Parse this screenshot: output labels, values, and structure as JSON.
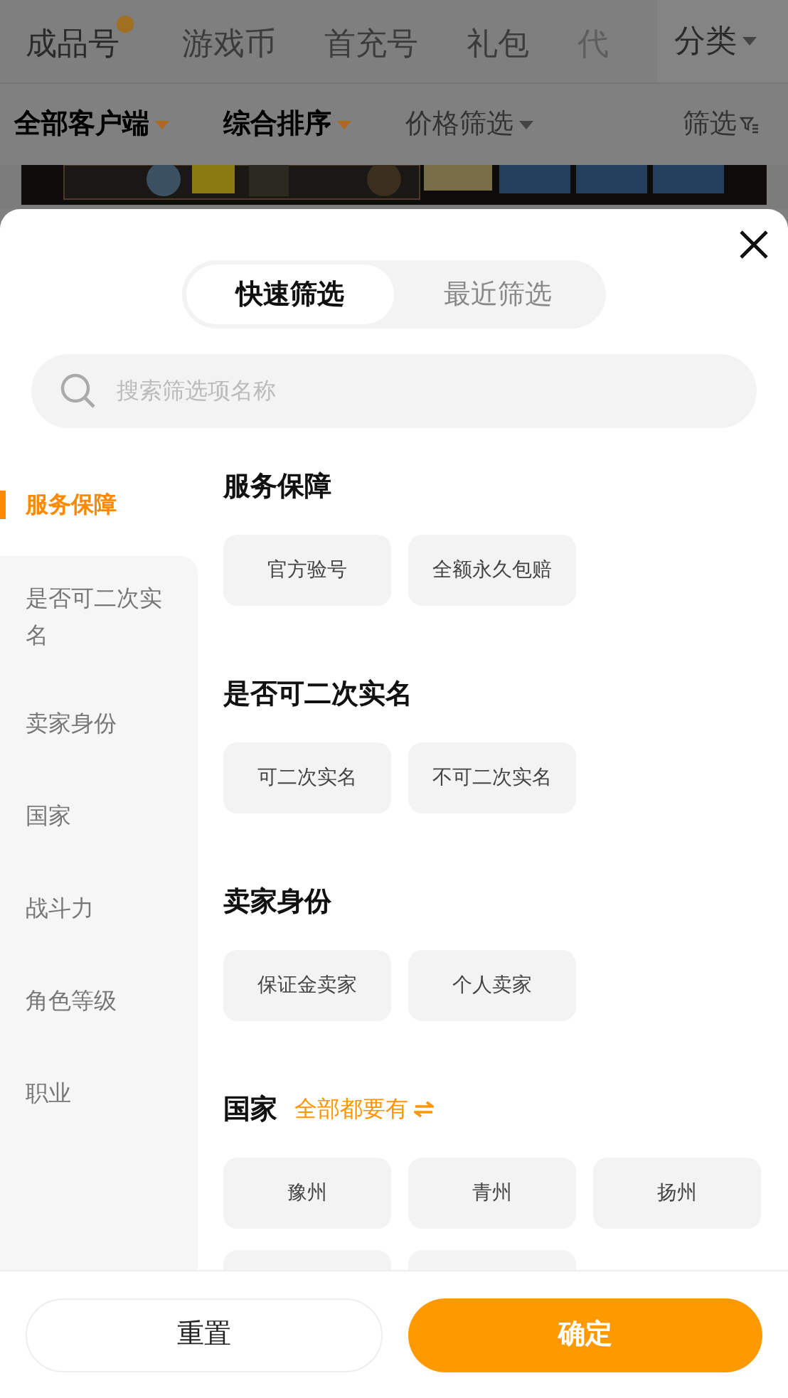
{
  "top_tabs": [
    {
      "label": "成品号",
      "selected": true
    },
    {
      "label": "游戏币",
      "selected": false
    },
    {
      "label": "首充号",
      "selected": false
    },
    {
      "label": "礼包",
      "selected": false
    },
    {
      "label": "代",
      "selected": false
    }
  ],
  "category_menu": {
    "label": "分类"
  },
  "filter_bar": [
    {
      "label": "全部客户端",
      "kind": "dropdown",
      "active": true
    },
    {
      "label": "综合排序",
      "kind": "dropdown",
      "active": true
    },
    {
      "label": "价格筛选",
      "kind": "dropdown",
      "active": false
    },
    {
      "label": "筛选",
      "kind": "filter",
      "active": false
    }
  ],
  "sheet": {
    "tabs": [
      {
        "label": "快速筛选",
        "selected": true
      },
      {
        "label": "最近筛选",
        "selected": false
      }
    ],
    "search": {
      "placeholder": "搜索筛选项名称"
    },
    "sidebar": [
      {
        "label": "服务保障",
        "selected": true
      },
      {
        "label": "是否可二次实名",
        "selected": false
      },
      {
        "label": "卖家身份",
        "selected": false
      },
      {
        "label": "国家",
        "selected": false
      },
      {
        "label": "战斗力",
        "selected": false
      },
      {
        "label": "角色等级",
        "selected": false
      },
      {
        "label": "职业",
        "selected": false
      }
    ],
    "sections": [
      {
        "title": "服务保障",
        "options": [
          {
            "kind": "chip",
            "label": "官方验号"
          },
          {
            "kind": "chip",
            "label": "全额永久包赔"
          }
        ]
      },
      {
        "title": "是否可二次实名",
        "options": [
          {
            "kind": "chip",
            "label": "可二次实名"
          },
          {
            "kind": "chip",
            "label": "不可二次实名"
          }
        ]
      },
      {
        "title": "卖家身份",
        "options": [
          {
            "kind": "chip",
            "label": "保证金卖家"
          },
          {
            "kind": "chip",
            "label": "个人卖家"
          }
        ]
      },
      {
        "title": "国家",
        "action": "全部都要有",
        "options": [
          {
            "kind": "chip",
            "label": "豫州"
          },
          {
            "kind": "chip",
            "label": "青州"
          },
          {
            "kind": "chip",
            "label": "扬州"
          },
          {
            "kind": "hidden"
          },
          {
            "kind": "hidden"
          }
        ]
      }
    ],
    "buttons": [
      {
        "label": "重置",
        "kind": "secondary"
      },
      {
        "label": "确定",
        "kind": "primary"
      }
    ]
  }
}
